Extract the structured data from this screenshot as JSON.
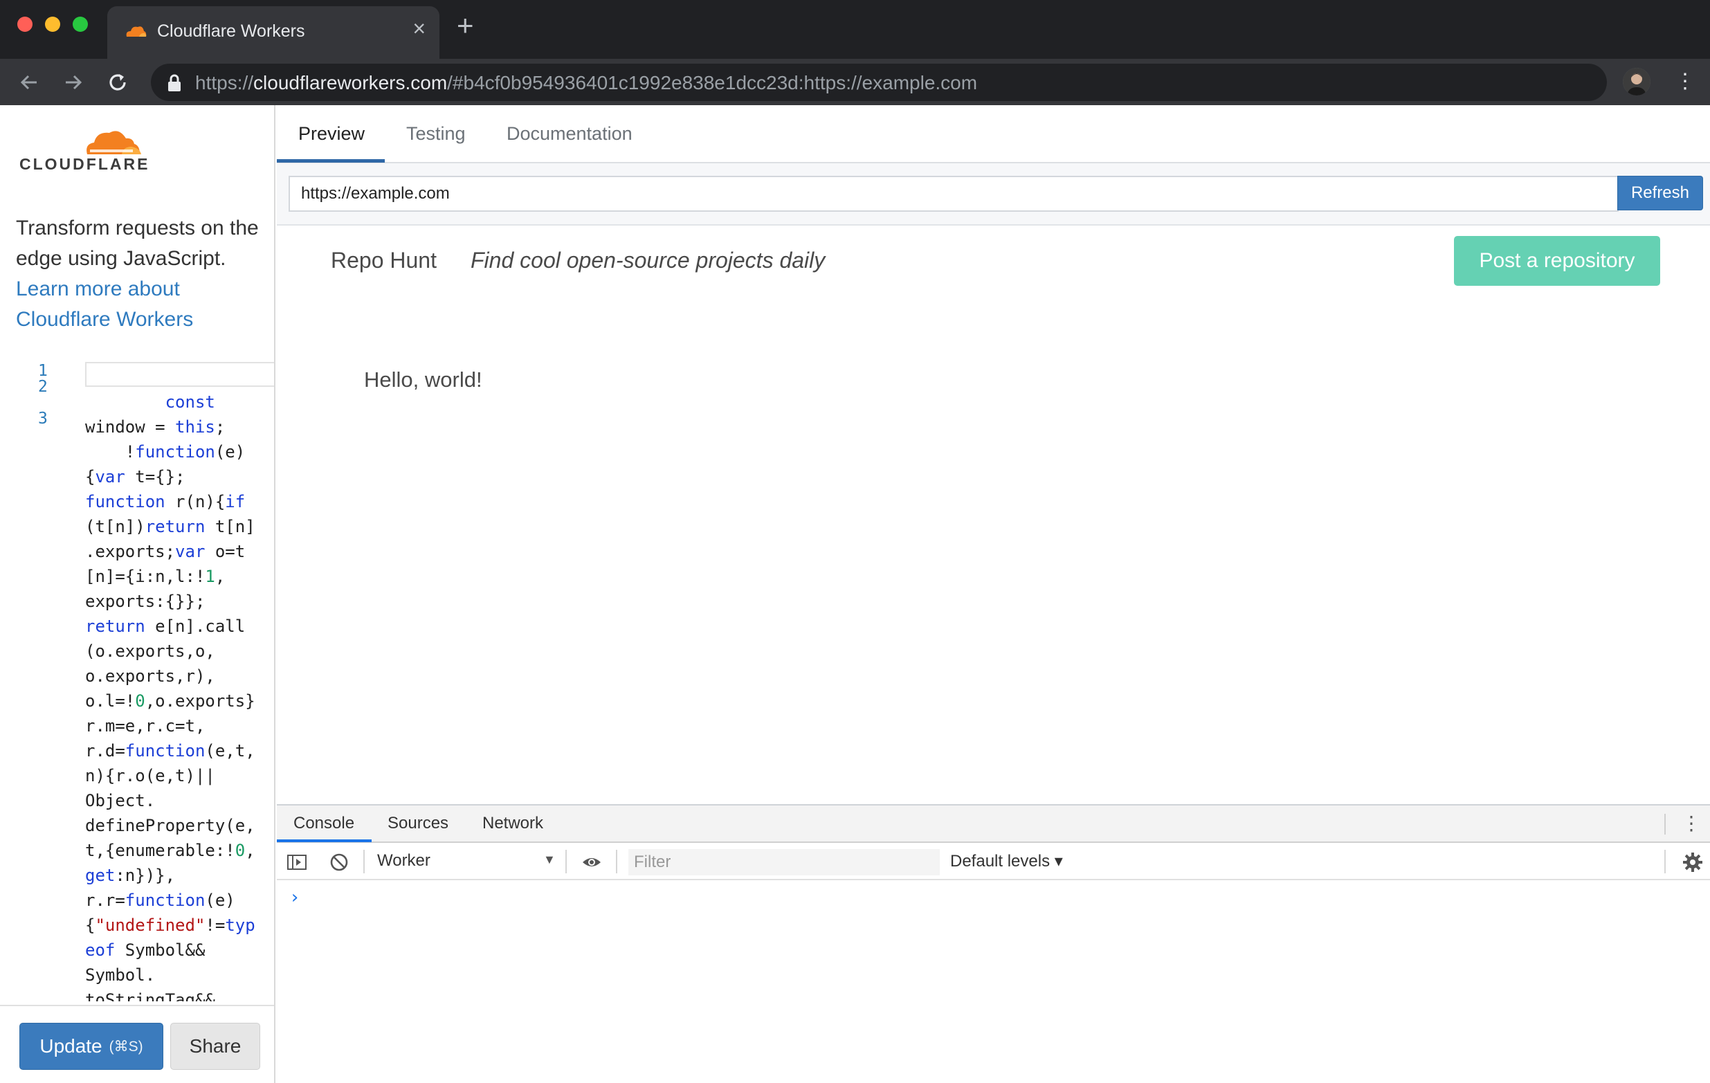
{
  "browser": {
    "tab_title": "Cloudflare Workers",
    "tab_close": "×",
    "new_tab": "+",
    "url_prefix": "https://",
    "url_host": "cloudflareworkers.com",
    "url_rest": "/#b4cf0b954936401c1992e838e1dcc23d:https://example.com"
  },
  "sidebar": {
    "logo_text": "CLOUDFLARE",
    "intro_text": "Transform requests on the edge using JavaScript.",
    "learn_more_link": "Learn more about Cloudflare Workers",
    "line_numbers": [
      "1",
      "2",
      "3"
    ],
    "update_label": "Update",
    "update_hint": "(⌘S)",
    "share_label": "Share"
  },
  "main": {
    "tabs": [
      {
        "label": "Preview"
      },
      {
        "label": "Testing"
      },
      {
        "label": "Documentation"
      }
    ],
    "url_value": "https://example.com",
    "refresh_label": "Refresh"
  },
  "preview": {
    "site_name": "Repo Hunt",
    "tagline": "Find cool open-source projects daily",
    "post_button": "Post a repository",
    "hello": "Hello, world!"
  },
  "devtools": {
    "tabs": [
      {
        "label": "Console"
      },
      {
        "label": "Sources"
      },
      {
        "label": "Network"
      }
    ],
    "context": "Worker",
    "filter_placeholder": "Filter",
    "levels": "Default levels ▾",
    "prompt": "›"
  },
  "colors": {
    "accent": "#3b7bbd",
    "post_button": "#65d1b3",
    "cloudflare_orange": "#f38020"
  }
}
